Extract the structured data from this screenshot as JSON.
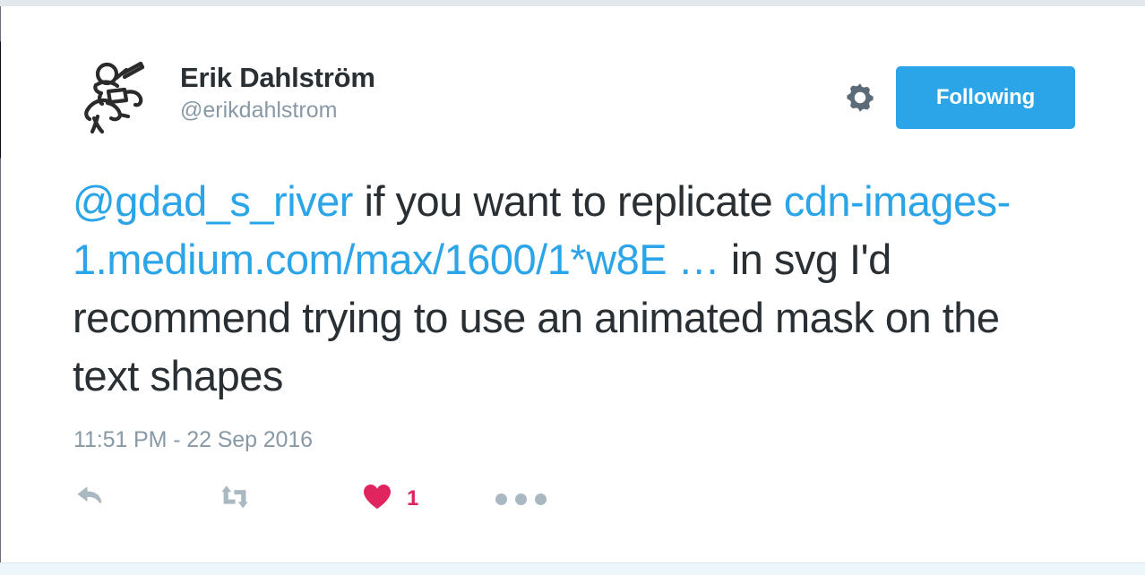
{
  "window": {
    "top_band_color": "#e3e8ed",
    "bottom_band_color": "#edf6fb"
  },
  "colors": {
    "link_blue": "#2ca5e8",
    "button_blue": "#2ca5e8",
    "like_red": "#e0245e",
    "icon_gray": "#aab8c2",
    "meta_gray": "#8899a6",
    "text_dark": "#292f33",
    "gear_gray": "#5b6b78"
  },
  "tweet": {
    "author": {
      "display_name": "Erik Dahlström",
      "handle": "@erikdahlstrom",
      "avatar_alt": "stick-figure-line-art-avatar"
    },
    "header_actions": {
      "gear_icon": "gear-icon",
      "follow_label": "Following"
    },
    "text_segments": [
      {
        "type": "mention",
        "text": "@gdad_s_river"
      },
      {
        "type": "plain",
        "text": " if you want to replicate "
      },
      {
        "type": "link",
        "text": "cdn-images-1.medium.com/max/1600/1*w8E …"
      },
      {
        "type": "plain",
        "text": " in svg I'd recommend trying to use an animated mask on the text shapes"
      }
    ],
    "text_plain": "@gdad_s_river if you want to replicate cdn-images-1.medium.com/max/1600/1*w8E … in svg I'd recommend trying to use an animated mask on the text shapes",
    "timestamp": "11:51 PM - 22 Sep 2016",
    "actions": {
      "reply": {
        "icon": "reply-icon",
        "count": ""
      },
      "retweet": {
        "icon": "retweet-icon",
        "count": ""
      },
      "like": {
        "icon": "heart-icon",
        "count": "1"
      },
      "more": {
        "icon": "more-ellipsis-icon",
        "count": ""
      }
    }
  }
}
